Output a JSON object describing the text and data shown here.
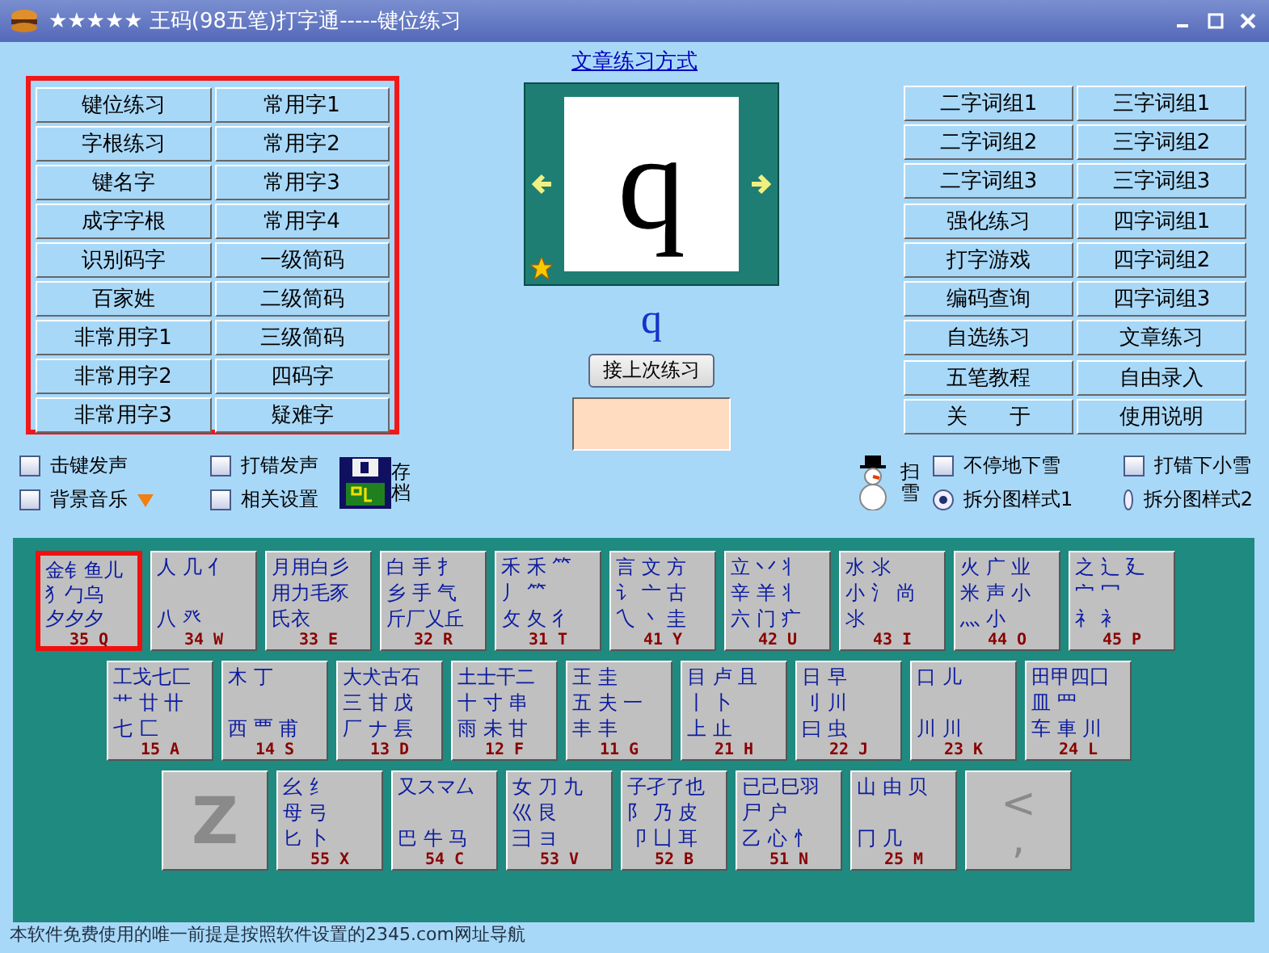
{
  "window": {
    "title": "★★★★★ 王码(98五笔)打字通-----键位练习"
  },
  "mode_link": "文章练习方式",
  "left_menu": [
    "键位练习",
    "常用字1",
    "字根练习",
    "常用字2",
    "键名字",
    "常用字3",
    "成字字根",
    "常用字4",
    "识别码字",
    "一级简码",
    "百家姓",
    "二级简码",
    "非常用字1",
    "三级简码",
    "非常用字2",
    "四码字",
    "非常用字3",
    "疑难字"
  ],
  "preview": {
    "char": "q",
    "code": "q",
    "resume_button": "接上次练习"
  },
  "right_menu": [
    "二字词组1",
    "三字词组1",
    "二字词组2",
    "三字词组2",
    "二字词组3",
    "三字词组3",
    "强化练习",
    "四字词组1",
    "打字游戏",
    "四字词组2",
    "编码查询",
    "四字词组3",
    "自选练习",
    "文章练习",
    "五笔教程",
    "自由录入",
    "关　　于",
    "使用说明"
  ],
  "options_left": [
    {
      "label": "击键发声",
      "checked": false
    },
    {
      "label": "打错发声",
      "checked": false
    },
    {
      "label": "背景音乐",
      "checked": false,
      "dropdown": true
    },
    {
      "label": "相关设置",
      "checked": false
    }
  ],
  "save_label": "存档",
  "sweep_label": "扫雪",
  "options_right": [
    {
      "kind": "checkbox",
      "label": "不停地下雪",
      "selected": false
    },
    {
      "kind": "checkbox",
      "label": "打错下小雪",
      "selected": false
    },
    {
      "kind": "radio",
      "label": "拆分图样式1",
      "selected": true
    },
    {
      "kind": "radio",
      "label": "拆分图样式2",
      "selected": false
    }
  ],
  "keyboard": [
    [
      {
        "kind": "roots",
        "code": "35 Q",
        "roots": [
          "金钅鱼儿",
          "犭勹乌",
          "夕夕夕"
        ],
        "selected": true
      },
      {
        "kind": "roots",
        "code": "34 W",
        "roots": [
          "人 几 亻",
          "八 癶"
        ],
        "selected": false
      },
      {
        "kind": "roots",
        "code": "33 E",
        "roots": [
          "月用白彡",
          "用力毛豕",
          "氏衣"
        ],
        "selected": false
      },
      {
        "kind": "roots",
        "code": "32 R",
        "roots": [
          "白 手 扌",
          "乡 手 气",
          "斤厂乂丘"
        ],
        "selected": false
      },
      {
        "kind": "roots",
        "code": "31 T",
        "roots": [
          "禾 禾 ⺮",
          "丿 ⺮",
          "攵 夂 彳"
        ],
        "selected": false
      },
      {
        "kind": "roots",
        "code": "41 Y",
        "roots": [
          "言 文 方",
          "讠 亠 古",
          "乀 丶 圭"
        ],
        "selected": false
      },
      {
        "kind": "roots",
        "code": "42 U",
        "roots": [
          "立 丷 丬",
          "辛 羊 丬",
          "六 门 疒"
        ],
        "selected": false
      },
      {
        "kind": "roots",
        "code": "43 I",
        "roots": [
          "水 氺",
          "小 氵 尚",
          "氺"
        ],
        "selected": false
      },
      {
        "kind": "roots",
        "code": "44 O",
        "roots": [
          "火 广 业",
          "米 声 小",
          "灬 小"
        ],
        "selected": false
      },
      {
        "kind": "roots",
        "code": "45 P",
        "roots": [
          "之 辶 廴",
          "宀 冖",
          "礻 衤"
        ],
        "selected": false
      }
    ],
    [
      {
        "kind": "roots",
        "code": "15 A",
        "roots": [
          "工戈七匚",
          "艹 廿 卄",
          "七 匚"
        ],
        "selected": false
      },
      {
        "kind": "roots",
        "code": "14 S",
        "roots": [
          "木 丁",
          "西 覀 甫"
        ],
        "selected": false
      },
      {
        "kind": "roots",
        "code": "13 D",
        "roots": [
          "大犬古石",
          "三 甘 戊",
          "厂 ナ 镸"
        ],
        "selected": false
      },
      {
        "kind": "roots",
        "code": "12 F",
        "roots": [
          "土士干二",
          "十 寸 串",
          "雨 未 甘"
        ],
        "selected": false
      },
      {
        "kind": "roots",
        "code": "11 G",
        "roots": [
          "王 圭",
          "五 夫 一",
          "丰 丰"
        ],
        "selected": false
      },
      {
        "kind": "roots",
        "code": "21 H",
        "roots": [
          "目 卢 且",
          "丨 卜",
          "上 止"
        ],
        "selected": false
      },
      {
        "kind": "roots",
        "code": "22 J",
        "roots": [
          "日 早",
          "刂 川",
          "曰 虫"
        ],
        "selected": false
      },
      {
        "kind": "roots",
        "code": "23 K",
        "roots": [
          "口 儿",
          "川 川"
        ],
        "selected": false
      },
      {
        "kind": "roots",
        "code": "24 L",
        "roots": [
          "田甲四囗",
          "皿 罒",
          "车 車 川"
        ],
        "selected": false
      }
    ],
    [
      {
        "kind": "letter",
        "label": "Z",
        "selected": false
      },
      {
        "kind": "roots",
        "code": "55 X",
        "roots": [
          "幺 纟",
          "母 弓",
          "匕 卜"
        ],
        "selected": false
      },
      {
        "kind": "roots",
        "code": "54 C",
        "roots": [
          "又スマ厶",
          "巴 牛 马"
        ],
        "selected": false
      },
      {
        "kind": "roots",
        "code": "53 V",
        "roots": [
          "女 刀 九",
          "巛 艮",
          "彐 ヨ"
        ],
        "selected": false
      },
      {
        "kind": "roots",
        "code": "52 B",
        "roots": [
          "子孑了也",
          "阝 乃 皮",
          "卩 凵 耳"
        ],
        "selected": false
      },
      {
        "kind": "roots",
        "code": "51 N",
        "roots": [
          "已己巳羽",
          "尸 户",
          "乙 心 忄"
        ],
        "selected": false
      },
      {
        "kind": "roots",
        "code": "25 M",
        "roots": [
          "山 由 贝",
          "冂 几"
        ],
        "selected": false
      },
      {
        "kind": "symbol",
        "label": "<",
        "sub": ",",
        "selected": false
      }
    ]
  ],
  "status_text": "本软件免费使用的唯一前提是按照软件设置的2345.com网址导航"
}
